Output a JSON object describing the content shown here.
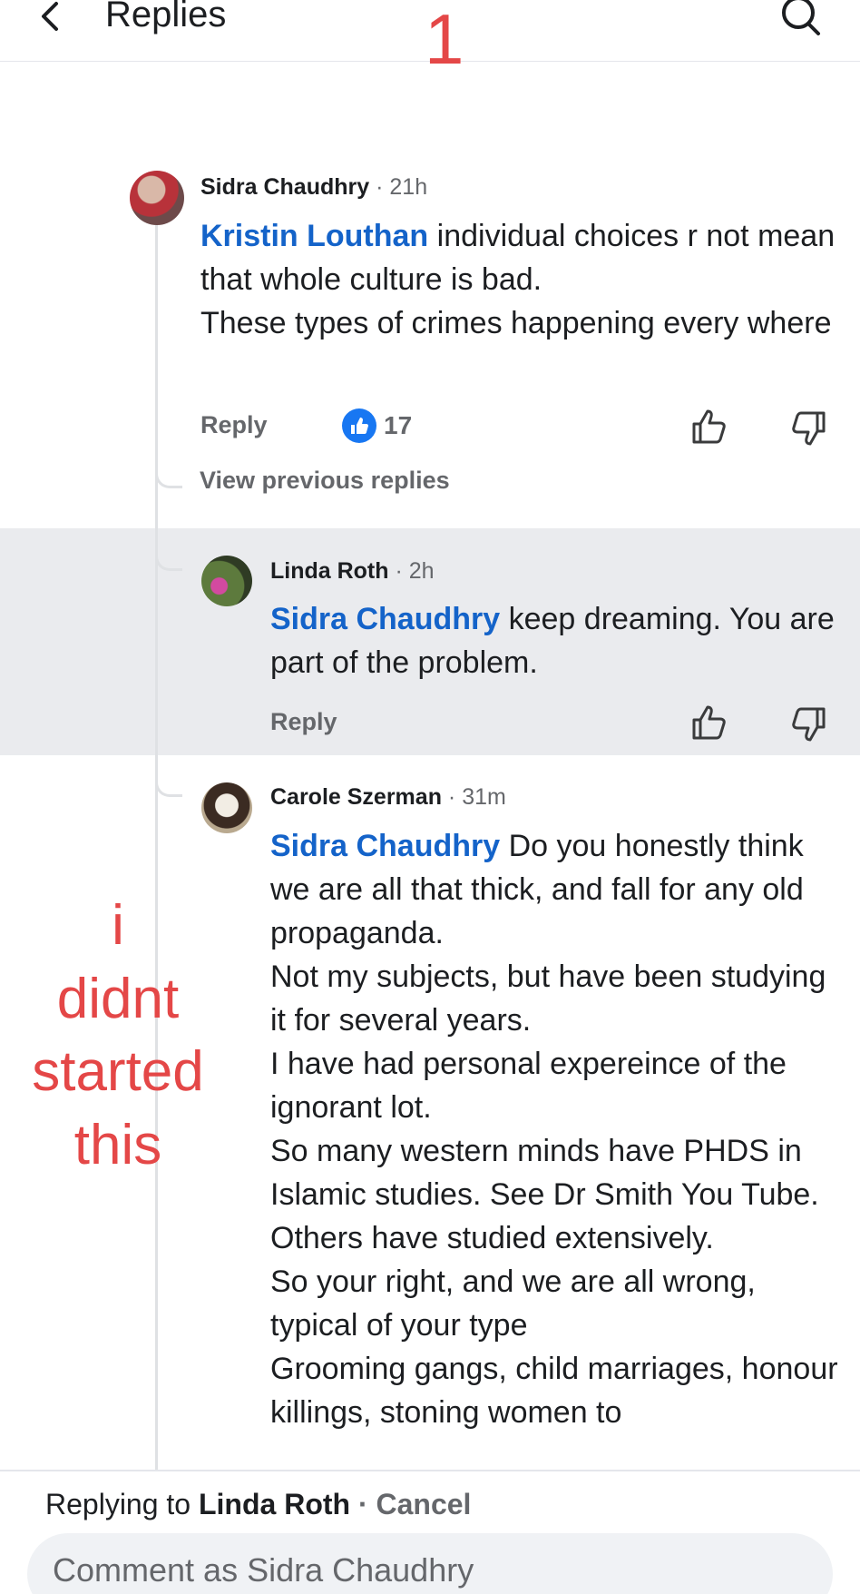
{
  "header": {
    "title": "Replies",
    "overlay_number": "1"
  },
  "parent_comment": {
    "author": "Sidra Chaudhry",
    "time": "· 21h",
    "mention": "Kristin Louthan",
    "text_after_mention": " individual choices r not mean that whole culture is bad.",
    "text_line2": "These types of crimes happening every where",
    "reply_label": "Reply",
    "like_count": "17"
  },
  "view_previous_replies": "View previous replies",
  "reply1": {
    "author": "Linda Roth",
    "time": "· 2h",
    "mention": "Sidra Chaudhry",
    "text": " keep dreaming.  You are part of the problem.",
    "reply_label": "Reply"
  },
  "reply2": {
    "author": "Carole Szerman",
    "time": "· 31m",
    "mention": "Sidra Chaudhry",
    "paragraphs": [
      " Do you honestly think we are all that thick, and fall for any old propaganda.",
      "Not my subjects,  but have been studying  it for several years.",
      "I have had personal expereince of the ignorant lot.",
      "So many western minds have PHDS in Islamic studies. See Dr Smith You Tube. Others have studied extensively.",
      "So your right, and we are all wrong, typical of your type",
      "Grooming gangs, child marriages, honour killings, stoning women to"
    ]
  },
  "overlay_annotation": {
    "line1": "i",
    "line2": "didnt",
    "line3": "started",
    "line4": "this"
  },
  "footer": {
    "replying_prefix": "Replying to ",
    "replying_name": "Linda Roth",
    "cancel": " · Cancel",
    "comment_placeholder": "Comment as Sidra Chaudhry"
  },
  "colors": {
    "mention_blue": "#1463c9",
    "like_blue": "#1877f2",
    "overlay_red": "#e44747",
    "highlight_gray": "#eaebee"
  }
}
